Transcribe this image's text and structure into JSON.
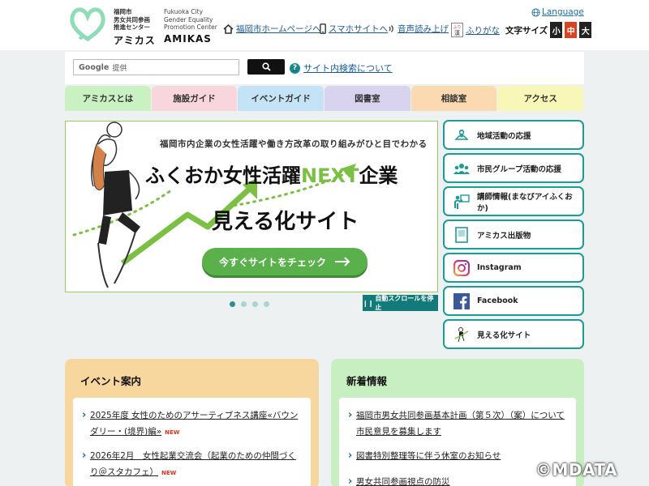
{
  "header": {
    "logo_jp_lines": [
      "福岡市",
      "男女共同参画",
      "推進センター"
    ],
    "logo_en_lines": [
      "Fukuoka City",
      "Gender Equality",
      "Promotion Center"
    ],
    "logo_name_jp": "アミカス",
    "logo_name_en": "AMIKAS",
    "language_label": "Language",
    "links": {
      "home": "福岡市ホームページへ",
      "smartphone": "スマホサイトへ",
      "voice": "音声読み上げ",
      "furigana": "ふりがな"
    },
    "font_size": {
      "label": "文字サイズ",
      "small": "小",
      "medium": "中",
      "large": "大",
      "colors": {
        "small": "#222222",
        "medium": "#d9431e",
        "large": "#222222"
      }
    }
  },
  "search": {
    "google_label": "Google",
    "placeholder": "提供",
    "about_label": "サイト内検索について"
  },
  "nav": {
    "tabs": [
      {
        "label": "アミカスとは",
        "color": "#c9f1c1"
      },
      {
        "label": "施設ガイド",
        "color": "#f9d6dd"
      },
      {
        "label": "イベントガイド",
        "color": "#c5e3f7"
      },
      {
        "label": "図書室",
        "color": "#d8d4ef"
      },
      {
        "label": "相談室",
        "color": "#fbd9b1"
      },
      {
        "label": "アクセス",
        "color": "#f8f7b8"
      }
    ]
  },
  "hero": {
    "tagline": "福岡市内企業の女性活躍や働き方改革の取り組みがひと目でわかる",
    "title_part1": "ふくおか女性活躍",
    "title_next": "NEXT",
    "title_part2": "企業",
    "subtitle": "見える化サイト",
    "cta_label": "今すぐサイトをチェック",
    "autoscroll_label": "自動スクロールを停止"
  },
  "side_menu": {
    "items": [
      {
        "label": "地域活動の応援",
        "icon": "map-pin-icon"
      },
      {
        "label": "市民グループ活動の応援",
        "icon": "group-icon"
      },
      {
        "label": "講師情報(まなびアイふくおか)",
        "icon": "lecturer-icon"
      },
      {
        "label": "アミカス出版物",
        "icon": "book-icon"
      },
      {
        "label": "Instagram",
        "icon": "instagram-icon"
      },
      {
        "label": "Facebook",
        "icon": "facebook-icon"
      },
      {
        "label": "見える化サイト",
        "icon": "woman-figure-icon"
      }
    ]
  },
  "events": {
    "title": "イベント案内",
    "items": [
      {
        "text": "2025年度 女性のためのアサーティブネス講座«バウンダリー・(境界)編»",
        "new": "NEW"
      },
      {
        "text": "2026年2月　女性起業交流会（起業のための仲間づくり＠スタカフェ）",
        "new": "NEW"
      }
    ]
  },
  "news": {
    "title": "新着情報",
    "items": [
      {
        "text": "福岡市男女共同参画基本計画（第５次）（案）について市民意見を募集します"
      },
      {
        "text": "図書特別整理等に伴う休室のお知らせ"
      },
      {
        "text": "男女共同参画視点の防災"
      }
    ]
  },
  "watermark": "©MDATA"
}
